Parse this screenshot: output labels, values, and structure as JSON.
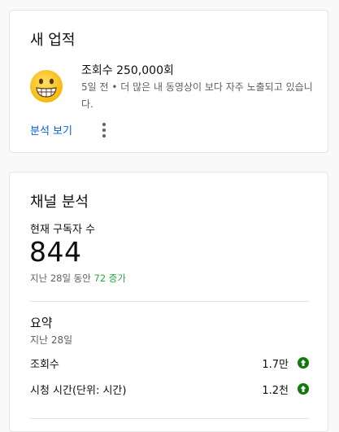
{
  "achievement": {
    "title": "새 업적",
    "emoji_icon": "grinning-face-icon",
    "headline": "조회수 250,000회",
    "description": "5일 전 • 더 많은 내 동영상이 보다 자주 노출되고 있습니다.",
    "link_label": "분석 보기",
    "more_icon": "more-vert-icon"
  },
  "analytics": {
    "title": "채널 분석",
    "subscriber_label": "현재 구독자 수",
    "subscriber_count": "844",
    "change_prefix": "지난 28일 동안",
    "change_value": "72 증가",
    "summary": {
      "title": "요약",
      "period": "지난 28일",
      "metrics": [
        {
          "label": "조회수",
          "value": "1.7만",
          "trend": "up"
        },
        {
          "label": "시청 시간(단위: 시간)",
          "value": "1.2천",
          "trend": "up"
        }
      ]
    }
  },
  "colors": {
    "link": "#065fd4",
    "positive": "#2ba640",
    "trend_icon": "#0f7b0f",
    "muted_text": "#606060"
  }
}
